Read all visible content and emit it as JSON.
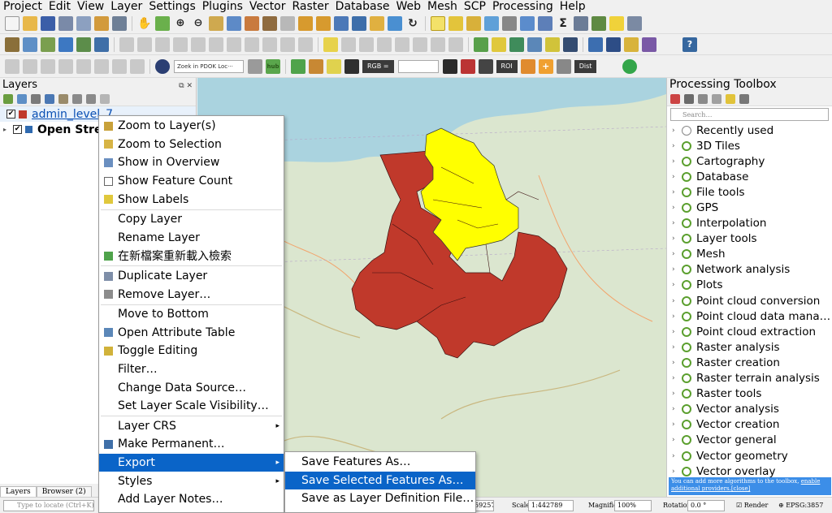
{
  "menubar": [
    "Project",
    "Edit",
    "View",
    "Layer",
    "Settings",
    "Plugins",
    "Vector",
    "Raster",
    "Database",
    "Web",
    "Mesh",
    "SCP",
    "Processing",
    "Help"
  ],
  "toolbar": {
    "locator_combo": "Zoek in PDOK Loc···",
    "rgb_label": "RGB =",
    "roi_label": "ROI",
    "dist_label": "Dist",
    "hub_label": "hub"
  },
  "layers_panel": {
    "title": "Layers",
    "layers": [
      {
        "name": "admin_level_7",
        "checked": true,
        "color": "#c0392b"
      },
      {
        "name": "Open Street",
        "checked": true
      }
    ],
    "tabs": [
      "Layers",
      "Browser (2)"
    ]
  },
  "context_menu": {
    "items": [
      {
        "label": "Zoom to Layer(s)",
        "icon": "zoom-layer-icon"
      },
      {
        "label": "Zoom to Selection",
        "icon": "zoom-selection-icon"
      },
      {
        "label": "Show in Overview",
        "icon": "overview-icon"
      },
      {
        "label": "Show Feature Count",
        "icon": "checkbox-icon"
      },
      {
        "label": "Show Labels",
        "icon": "labels-icon"
      },
      {
        "label": "Copy Layer",
        "icon": ""
      },
      {
        "label": "Rename Layer",
        "icon": ""
      },
      {
        "label": "在新檔案重新載入檢索",
        "icon": "reload-icon"
      },
      {
        "label": "Duplicate Layer",
        "icon": "duplicate-icon"
      },
      {
        "label": "Remove Layer…",
        "icon": "remove-icon"
      },
      {
        "label": "Move to Bottom",
        "icon": ""
      },
      {
        "label": "Open Attribute Table",
        "icon": "table-icon"
      },
      {
        "label": "Toggle Editing",
        "icon": "pencil-icon"
      },
      {
        "label": "Filter…",
        "icon": ""
      },
      {
        "label": "Change Data Source…",
        "icon": ""
      },
      {
        "label": "Set Layer Scale Visibility…",
        "icon": ""
      },
      {
        "label": "Layer CRS",
        "icon": "",
        "submenu": true
      },
      {
        "label": "Make Permanent…",
        "icon": "save-icon"
      },
      {
        "label": "Export",
        "icon": "",
        "submenu": true,
        "highlight": true
      },
      {
        "label": "Styles",
        "icon": "",
        "submenu": true
      },
      {
        "label": "Add Layer Notes…",
        "icon": ""
      }
    ],
    "export_submenu": [
      "Save Features As…",
      "Save Selected Features As…",
      "Save as Layer Definition File…"
    ]
  },
  "toolbox": {
    "title": "Processing Toolbox",
    "search_placeholder": "Search…",
    "items": [
      "Recently used",
      "3D Tiles",
      "Cartography",
      "Database",
      "File tools",
      "GPS",
      "Interpolation",
      "Layer tools",
      "Mesh",
      "Network analysis",
      "Plots",
      "Point cloud conversion",
      "Point cloud data mana…",
      "Point cloud extraction",
      "Raster analysis",
      "Raster creation",
      "Raster terrain analysis",
      "Raster tools",
      "Vector analysis",
      "Vector creation",
      "Vector general",
      "Vector geometry",
      "Vector overlay"
    ],
    "note_text": "You can add more algorithms to the toolbox, ",
    "note_link": "enable additional providers.",
    "note_close": "[close]"
  },
  "statusbar": {
    "locate_placeholder": "Type to locate (Ctrl+K)",
    "coordinate": "59257",
    "scale_label": "Scale",
    "scale_value": "1:442789",
    "magnifier_label": "Magnifier",
    "magnifier_value": "100%",
    "rotation_label": "Rotation",
    "rotation_value": "0.0 °",
    "render_label": "Render",
    "crs": "EPSG:3857"
  },
  "map": {
    "red_fill": "#c0392b",
    "yellow_fill": "#ffff00",
    "sea": "#aad3df",
    "land": "#dbe6cf"
  }
}
